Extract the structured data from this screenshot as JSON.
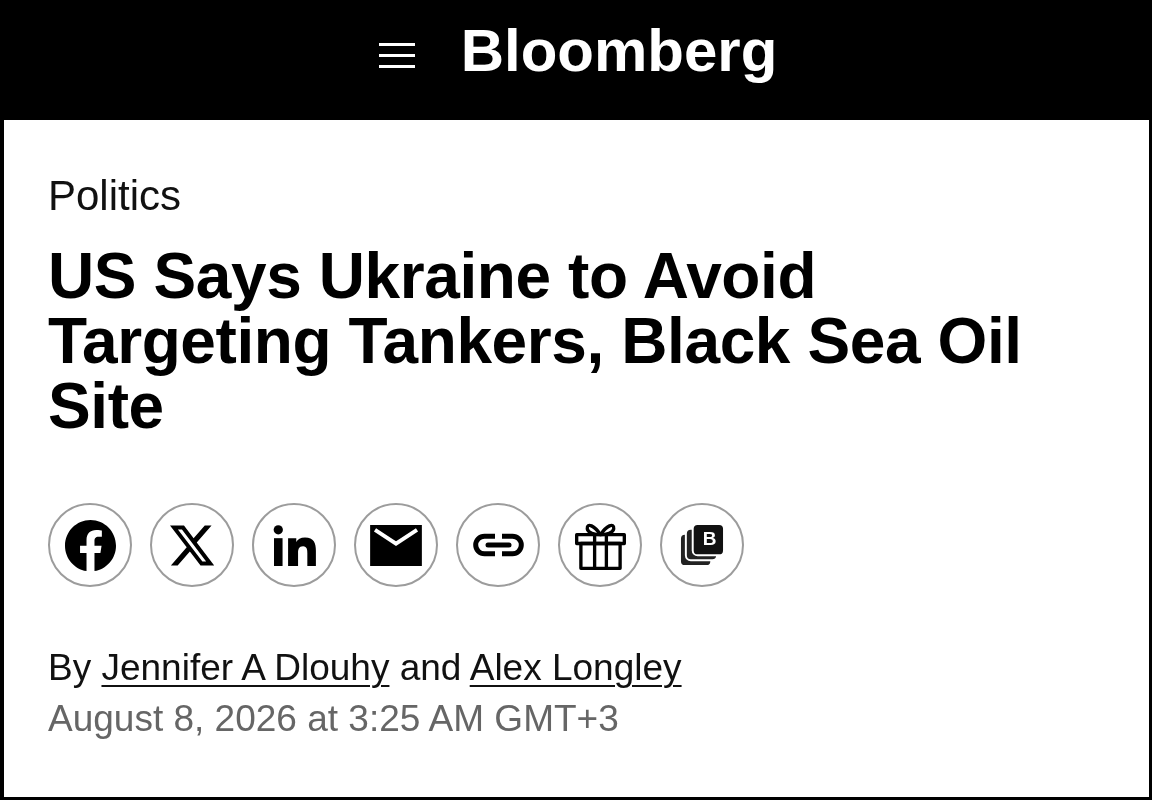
{
  "header": {
    "logo": "Bloomberg"
  },
  "article": {
    "section": "Politics",
    "headline": "US Says Ukraine to Avoid Targeting Tankers, Black Sea Oil Site",
    "share_buttons": [
      {
        "kind": "facebook"
      },
      {
        "kind": "x"
      },
      {
        "kind": "linkedin"
      },
      {
        "kind": "email"
      },
      {
        "kind": "link"
      },
      {
        "kind": "gift"
      },
      {
        "kind": "tiles",
        "letter": "B"
      }
    ],
    "byline": {
      "prefix": "By",
      "authors": [
        "Jennifer A Dlouhy",
        "Alex Longley"
      ],
      "conjunction": "and"
    },
    "timestamp": "August 8, 2026 at 3:25 AM GMT+3"
  }
}
